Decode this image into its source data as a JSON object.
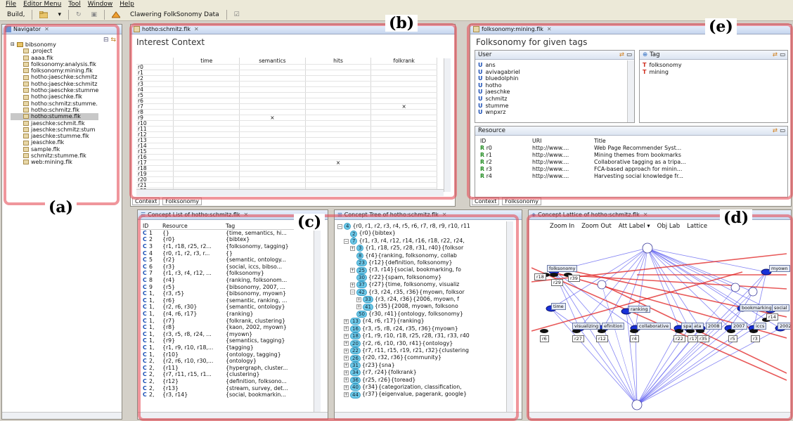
{
  "menu": [
    "File",
    "Editor Menu",
    "Tool",
    "Window",
    "Help"
  ],
  "toolbar": {
    "build_label": "Build,",
    "crawl_label": "Clawering FolkSonomy Data"
  },
  "callouts": {
    "a": "(a)",
    "b": "(b)",
    "c": "(c)",
    "d": "(d)",
    "e": "(e)"
  },
  "navigator": {
    "title": "Navigator",
    "root": "bibsonomy",
    "items": [
      ".project",
      "aaaa.flk",
      "folksonomy:analysis.flk",
      "folksonomy:mining.flk",
      "hotho:jaeschke:schmitz",
      "hotho:jaeschke:schmitz",
      "hotho:jaeschke:stumme",
      "hotho:jaeschke.flk",
      "hotho:schmitz:stumme.",
      "hotho:schmitz.flk",
      "hotho:stumme.flk",
      "jaeschke:schmit.flk",
      "jaeschke:schmitz:stum",
      "jaeschke:stumme.flk",
      "jeaschke.flk",
      "sample.flk",
      "schmitz:stumme.flk",
      "web:mining.flk"
    ],
    "selected_index": 10
  },
  "interest": {
    "tab": "hotho:schmitz.flk",
    "title": "Interest Context",
    "columns": [
      "",
      "time",
      "semantics",
      "hits",
      "folkrank"
    ],
    "rows": [
      "r0",
      "r1",
      "r2",
      "r3",
      "r4",
      "r5",
      "r6",
      "r7",
      "r8",
      "r9",
      "r10",
      "r11",
      "r12",
      "r13",
      "r14",
      "r15",
      "r16",
      "r17",
      "r18",
      "r19",
      "r20",
      "r21",
      "r22"
    ],
    "marks": [
      {
        "row": 7,
        "col": 4
      },
      {
        "row": 9,
        "col": 2
      },
      {
        "row": 17,
        "col": 3
      }
    ],
    "mark_glyph": "×",
    "bottom_tabs": [
      "Context",
      "Folksonomy"
    ]
  },
  "folksonomy": {
    "tab": "folksonomy:mining.flk",
    "title": "Folksonomy for given tags",
    "user_label": "User",
    "tag_label": "Tag",
    "users": [
      "ans",
      "avivagabriel",
      "bluedolphin",
      "hotho",
      "jaeschke",
      "schmitz",
      "stumme",
      "wnpxrz"
    ],
    "tags": [
      "folksonomy",
      "mining"
    ],
    "resource_label": "Resource",
    "resource_columns": [
      "ID",
      "URI",
      "Title"
    ],
    "resources": [
      {
        "id": "r0",
        "uri": "http://www....",
        "title": "Web Page Recommender Syst..."
      },
      {
        "id": "r1",
        "uri": "http://www....",
        "title": "Mining themes from bookmarks"
      },
      {
        "id": "r2",
        "uri": "http://www....",
        "title": "Collaborative tagging as a tripa..."
      },
      {
        "id": "r3",
        "uri": "http://www....",
        "title": "FCA-based approach for minin..."
      },
      {
        "id": "r4",
        "uri": "http://www....",
        "title": "Harvesting social knowledge fr..."
      }
    ],
    "bottom_tabs": [
      "Context",
      "Folksonomy"
    ]
  },
  "concept_list": {
    "tab": "Concept List of hotho:schmitz.flk",
    "columns": [
      "ID",
      "Resource",
      "Tag"
    ],
    "rows": [
      [
        "1",
        "{}",
        "{time, semantics, hi..."
      ],
      [
        "2",
        "{r0}",
        "{bibtex}"
      ],
      [
        "3",
        "{r1, r18, r25, r2...",
        "{folksonomy, tagging}"
      ],
      [
        "4",
        "{r0, r1, r2, r3, r...",
        "{}"
      ],
      [
        "5",
        "{r2}",
        "{semantic, ontology..."
      ],
      [
        "6",
        "{r3}",
        "{social, iccs, bibso..."
      ],
      [
        "7",
        "{r1, r3, r4, r12, ...",
        "{folksonomy}"
      ],
      [
        "8",
        "{r4}",
        "{ranking, folksonom..."
      ],
      [
        "9",
        "{r5}",
        "{bibsonomy, 2007, ..."
      ],
      [
        "1,",
        "{r3, r5}",
        "{bibsonomy, myown}"
      ],
      [
        "1,",
        "{r6}",
        "{semantic, ranking, ..."
      ],
      [
        "1,",
        "{r2, r6, r30}",
        "{semantic, ontology}"
      ],
      [
        "1,",
        "{r4, r6, r17}",
        "{ranking}"
      ],
      [
        "1,",
        "{r7}",
        "{folkrank, clustering}"
      ],
      [
        "1,",
        "{r8}",
        "{kaon, 2002, myown}"
      ],
      [
        "1,",
        "{r3, r5, r8, r24, ...",
        "{myown}"
      ],
      [
        "1,",
        "{r9}",
        "{semantics, tagging}"
      ],
      [
        "1,",
        "{r1, r9, r10, r18,...",
        "{tagging}"
      ],
      [
        "1,",
        "{r10}",
        "{ontology, tagging}"
      ],
      [
        "2,",
        "{r2, r6, r10, r30,...",
        "{ontology}"
      ],
      [
        "2,",
        "{r11}",
        "{hypergraph, cluster..."
      ],
      [
        "2,",
        "{r7, r11, r15, r1...",
        "{clustering}"
      ],
      [
        "2,",
        "{r12}",
        "{definition, folksono..."
      ],
      [
        "2,",
        "{r13}",
        "{stream, survey, det..."
      ],
      [
        "2,",
        "{r3, r14}",
        "{social, bookmarkin..."
      ]
    ]
  },
  "concept_tree": {
    "tab": "Concept Tree of hotho:schmitz.flk",
    "rows": [
      {
        "indent": 0,
        "pm": "-",
        "n": "4",
        "t": "{r0, r1, r2, r3, r4, r5, r6, r7, r8, r9, r10, r11"
      },
      {
        "indent": 1,
        "pm": "",
        "n": "2",
        "t": "{r0}{bibtex}"
      },
      {
        "indent": 1,
        "pm": "-",
        "n": "7",
        "t": "{r1, r3, r4, r12, r14, r16, r18, r22, r24,"
      },
      {
        "indent": 2,
        "pm": "+",
        "n": "3",
        "t": "{r1, r18, r25, r28, r31, r40}{folksor"
      },
      {
        "indent": 2,
        "pm": "",
        "n": "8",
        "t": "{r4}{ranking, folksonomy, collab"
      },
      {
        "indent": 2,
        "pm": "",
        "n": "23",
        "t": "{r12}{definition, folksonomy}"
      },
      {
        "indent": 2,
        "pm": "+",
        "n": "25",
        "t": "{r3, r14}{social, bookmarking, fo"
      },
      {
        "indent": 2,
        "pm": "",
        "n": "30",
        "t": "{r22}{spam, folksonomy}"
      },
      {
        "indent": 2,
        "pm": "+",
        "n": "37",
        "t": "{r27}{time, folksonomy, visualiz"
      },
      {
        "indent": 2,
        "pm": "-",
        "n": "42",
        "t": "{r3, r24, r35, r36}{myown, folksor"
      },
      {
        "indent": 3,
        "pm": "+",
        "n": "33",
        "t": "{r3, r24, r36}{2006, myown, f"
      },
      {
        "indent": 3,
        "pm": "+",
        "n": "41",
        "t": "{r35}{2008, myown, folksono"
      },
      {
        "indent": 2,
        "pm": "",
        "n": "50",
        "t": "{r30, r41}{ontology, folksonomy}"
      },
      {
        "indent": 1,
        "pm": "+",
        "n": "13",
        "t": "{r4, r6, r17}{ranking}"
      },
      {
        "indent": 1,
        "pm": "+",
        "n": "16",
        "t": "{r3, r5, r8, r24, r35, r36}{myown}"
      },
      {
        "indent": 1,
        "pm": "+",
        "n": "18",
        "t": "{r1, r9, r10, r18, r25, r28, r31, r33, r40"
      },
      {
        "indent": 1,
        "pm": "+",
        "n": "20",
        "t": "{r2, r6, r10, r30, r41}{ontology}"
      },
      {
        "indent": 1,
        "pm": "+",
        "n": "22",
        "t": "{r7, r11, r15, r19, r21, r32}{clustering"
      },
      {
        "indent": 1,
        "pm": "+",
        "n": "26",
        "t": "{r20, r32, r36}{community}"
      },
      {
        "indent": 1,
        "pm": "+",
        "n": "31",
        "t": "{r23}{sna}"
      },
      {
        "indent": 1,
        "pm": "+",
        "n": "34",
        "t": "{r7, r24}{folkrank}"
      },
      {
        "indent": 1,
        "pm": "+",
        "n": "36",
        "t": "{r25, r26}{toread}"
      },
      {
        "indent": 1,
        "pm": "+",
        "n": "40",
        "t": "{r34}{categorization, classification,"
      },
      {
        "indent": 1,
        "pm": "+",
        "n": "44",
        "t": "{r37}{eigenvalue, pagerank, google}"
      }
    ]
  },
  "lattice": {
    "tab": "Concept Lattice of hotho:schmitz.flk",
    "tools": [
      "Zoom In",
      "Zoom Out",
      "Att Label ▾",
      "Obj Lab",
      "Lattice"
    ],
    "attr_labels": [
      {
        "text": "folksonomy"
      },
      {
        "text": "myown"
      },
      {
        "text": "time"
      },
      {
        "text": "ranking"
      },
      {
        "text": "bookmarking"
      },
      {
        "text": "social"
      },
      {
        "text": "visualizing"
      },
      {
        "text": "efinition"
      },
      {
        "text": "collaborative"
      },
      {
        "text": "spam"
      },
      {
        "text": "ata"
      },
      {
        "text": "2008"
      },
      {
        "text": "2007"
      },
      {
        "text": "iccs"
      },
      {
        "text": "2002"
      }
    ],
    "obj_labels": [
      {
        "text": "r18"
      },
      {
        "text": "r29"
      },
      {
        "text": "r39"
      },
      {
        "text": "r14"
      },
      {
        "text": "r6"
      },
      {
        "text": "r27"
      },
      {
        "text": "r12"
      },
      {
        "text": "r4"
      },
      {
        "text": "r22"
      },
      {
        "text": "r17"
      },
      {
        "text": "r35"
      },
      {
        "text": "r5"
      },
      {
        "text": "r3"
      }
    ]
  },
  "colors": {
    "callout_border": "#e6505a",
    "lattice_blue": "#5b5bf0",
    "lattice_red": "#e02020",
    "user_icon": "#1b4fb5",
    "tag_icon": "#d03020",
    "resource_icon": "#1e8a1e"
  }
}
